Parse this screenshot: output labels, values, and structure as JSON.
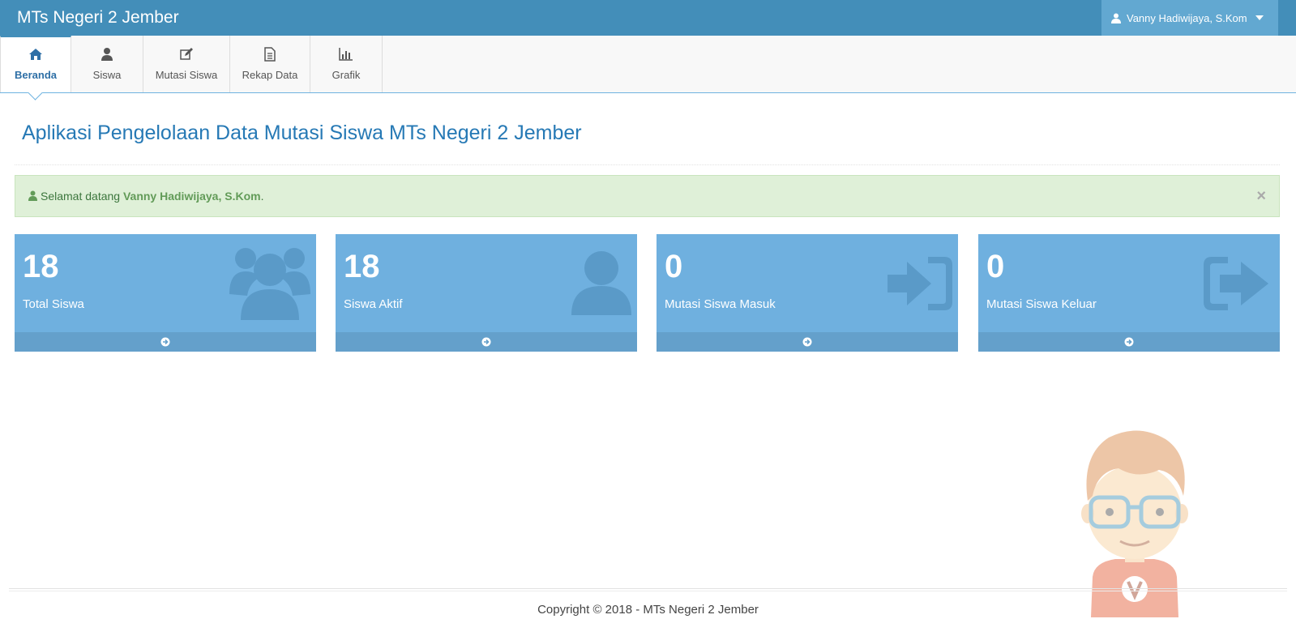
{
  "app": {
    "brand": "MTs Negeri 2 Jember"
  },
  "user_menu": {
    "name": "Vanny Hadiwijaya, S.Kom"
  },
  "nav": {
    "items": [
      {
        "label": "Beranda",
        "icon": "home-icon",
        "active": true
      },
      {
        "label": "Siswa",
        "icon": "user-icon"
      },
      {
        "label": "Mutasi Siswa",
        "icon": "edit-icon"
      },
      {
        "label": "Rekap Data",
        "icon": "document-icon"
      },
      {
        "label": "Grafik",
        "icon": "bar-chart-icon"
      }
    ]
  },
  "page": {
    "title": "Aplikasi Pengelolaan Data Mutasi Siswa MTs Negeri 2 Jember"
  },
  "alert": {
    "prefix": "Selamat datang ",
    "name": "Vanny Hadiwijaya, S.Kom",
    "suffix": ".",
    "close": "×"
  },
  "stats": [
    {
      "value": "18",
      "label": "Total Siswa",
      "icon": "users-icon"
    },
    {
      "value": "18",
      "label": "Siswa Aktif",
      "icon": "user-icon"
    },
    {
      "value": "0",
      "label": "Mutasi Siswa Masuk",
      "icon": "sign-in-icon"
    },
    {
      "value": "0",
      "label": "Mutasi Siswa Keluar",
      "icon": "sign-out-icon"
    }
  ],
  "footer": {
    "copyright": "Copyright © 2018 - MTs Negeri 2 Jember"
  },
  "colors": {
    "topbar": "#438eb9",
    "stat_box": "#6fb0df",
    "alert_bg": "#dff0d8",
    "title": "#2679b5"
  }
}
